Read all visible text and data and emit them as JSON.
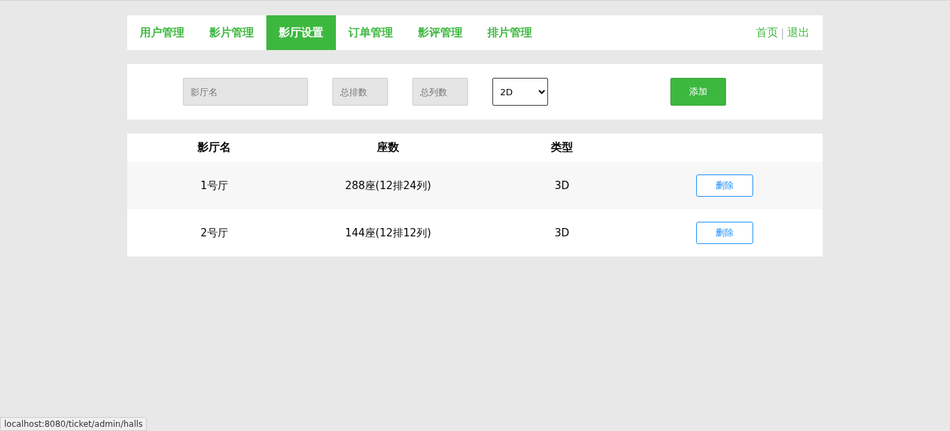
{
  "nav": {
    "tabs": [
      {
        "label": "用户管理",
        "selected": false
      },
      {
        "label": "影片管理",
        "selected": false
      },
      {
        "label": "影厅设置",
        "selected": true
      },
      {
        "label": "订单管理",
        "selected": false
      },
      {
        "label": "影评管理",
        "selected": false
      },
      {
        "label": "排片管理",
        "selected": false
      }
    ],
    "links": [
      "首页",
      "退出"
    ],
    "separator": "|"
  },
  "form": {
    "name_field": {
      "placeholder": "影厅名"
    },
    "rows_field": {
      "placeholder": "总排数"
    },
    "cols_field": {
      "placeholder": "总列数"
    },
    "type_select": {
      "value": "2D"
    },
    "add_button": "添加"
  },
  "table": {
    "columns": [
      "影厅名",
      "座数",
      "类型"
    ],
    "rows": [
      {
        "name": "1号厅",
        "seats": "288座(12排24列)",
        "type": "3D",
        "action": "删除"
      },
      {
        "name": "2号厅",
        "seats": "144座(12排12列)",
        "type": "3D",
        "action": "删除"
      }
    ]
  },
  "status_bar": "localhost:8080/ticket/admin/halls"
}
